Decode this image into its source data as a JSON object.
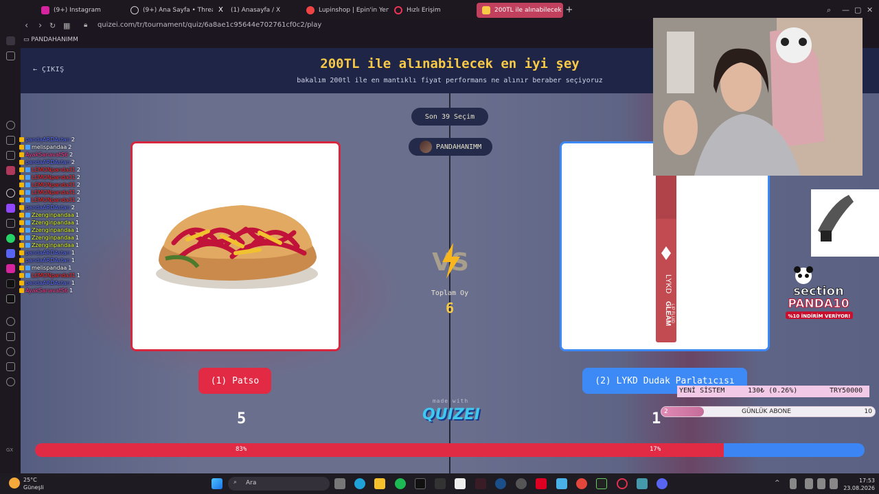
{
  "browser": {
    "tabs": [
      {
        "label": "(9+) Instagram",
        "color": "#d6249f"
      },
      {
        "label": "(9+) Ana Sayfa • Threads",
        "color": "#cccccc"
      },
      {
        "label": "(1) Anasayfa / X",
        "color": "#ffffff"
      },
      {
        "label": "Lupinshop | Epin'in Yeni Mer",
        "color": "#e44"
      },
      {
        "label": "Hızlı Erişim",
        "color": "#e35"
      },
      {
        "label": "200TL ile alınabilecek en iy",
        "color": "#f7c947"
      }
    ],
    "url": "quizei.com/tr/tournament/quiz/6a8ae1c95644e702761cf0c2/play",
    "bookmark": "PANDAHANIMM"
  },
  "quiz": {
    "exit_label": "ÇIKIŞ",
    "title": "200TL ile alınabilecek en iyi şey",
    "subtitle": "bakalım 200tl ile en mantıklı fiyat performans ne alınır beraber seçiyoruz",
    "last_choices": "Son 39 Seçim",
    "user": "PANDAHANIMM",
    "total_votes_label": "Toplam Oy",
    "total_votes": "6",
    "left_option": {
      "label": "(1) Patso",
      "votes": "5",
      "percent_label": "83%",
      "percent": 83
    },
    "right_option": {
      "label": "(2) LYKD Dudak Parlatıcısı",
      "votes": "1",
      "percent_label": "17%",
      "percent": 17
    },
    "made_with": "made with",
    "brand": "QUIZEI",
    "product_text": [
      "LYKD",
      "GLEAM",
      "LIP FLUID"
    ]
  },
  "chat": [
    {
      "name": "pandaARDAstan",
      "count": "2",
      "color": "#5b6cff"
    },
    {
      "name": "melispandaa",
      "count": "2",
      "color": "#ffffff",
      "badge2": true
    },
    {
      "name": "AyakSanavatS6",
      "count": "2",
      "color": "#ff3c8a"
    },
    {
      "name": "pandaARDAstan",
      "count": "2",
      "color": "#5b6cff"
    },
    {
      "name": "LEMONpanda31",
      "count": "2",
      "color": "#ff2b2b",
      "badge2": true
    },
    {
      "name": "LEMONpanda31",
      "count": "2",
      "color": "#ff2b2b",
      "badge2": true
    },
    {
      "name": "LEMONpanda31",
      "count": "2",
      "color": "#ff2b2b",
      "badge2": true
    },
    {
      "name": "LEMONpanda31",
      "count": "2",
      "color": "#ff2b2b",
      "badge2": true
    },
    {
      "name": "LEMONpanda31",
      "count": "2",
      "color": "#ff2b2b",
      "badge2": true
    },
    {
      "name": "pandaARDAstan",
      "count": "2",
      "color": "#5b6cff"
    },
    {
      "name": "Zzenginpandaa",
      "count": "1",
      "color": "#e8ff2b",
      "badge2": true
    },
    {
      "name": "Zzenginpandaa",
      "count": "1",
      "color": "#e8ff2b",
      "badge2": true
    },
    {
      "name": "Zzenginpandaa",
      "count": "1",
      "color": "#e8ff2b",
      "badge2": true
    },
    {
      "name": "Zzenginpandaa",
      "count": "1",
      "color": "#e8ff2b",
      "badge2": true
    },
    {
      "name": "Zzenginpandaa",
      "count": "1",
      "color": "#e8ff2b",
      "badge2": true
    },
    {
      "name": "pandaARDAstan",
      "count": "1",
      "color": "#5b6cff"
    },
    {
      "name": "pandaARDAstan",
      "count": "1",
      "color": "#5b6cff"
    },
    {
      "name": "melispandaa",
      "count": "1",
      "color": "#ffffff",
      "badge2": true
    },
    {
      "name": "LEMONpanda31",
      "count": "1",
      "color": "#ff2b2b",
      "badge2": true
    },
    {
      "name": "pandaARDAstan",
      "count": "1",
      "color": "#5b6cff"
    },
    {
      "name": "AyakSanavatS6",
      "count": "1",
      "color": "#ff3c8a"
    }
  ],
  "overlay": {
    "panda_title": "section",
    "panda_brand": "PANDA10",
    "panda_tag": "%10 İNDİRİM VERİYOR!",
    "ticker_left": "YENİ SİSTEM",
    "ticker_mid": "130₺ (0.26%)",
    "ticker_right": "TRY50000",
    "sub_label": "GÜNLÜK ABONE",
    "sub_current": "2",
    "sub_goal": "10",
    "sub_fraction": 0.2
  },
  "taskbar": {
    "temp": "25°C",
    "weather": "Güneşli",
    "search": "Ara",
    "time": "17:53",
    "date": "23.08.2026"
  }
}
